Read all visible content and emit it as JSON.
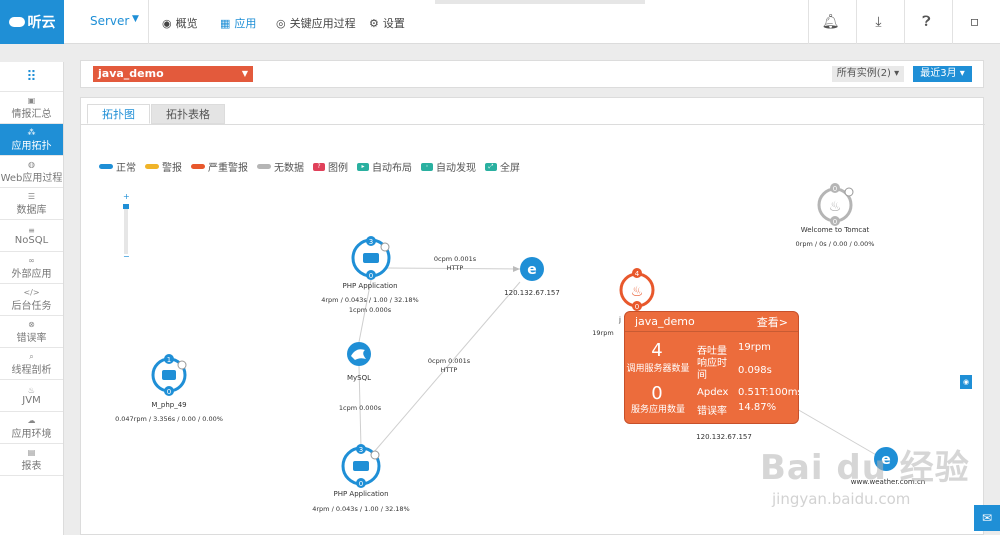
{
  "app": {
    "brand": "听云",
    "product_selector": "Server"
  },
  "topnav": {
    "items": [
      {
        "label": "概览",
        "icon": "eye-icon"
      },
      {
        "label": "应用",
        "icon": "grid-icon"
      },
      {
        "label": "关键应用过程",
        "icon": "target-icon"
      },
      {
        "label": "设置",
        "icon": "gear-icon"
      }
    ],
    "active": "应用",
    "right_icons": [
      "bell-icon",
      "download-icon",
      "help-icon",
      "user-icon"
    ]
  },
  "sidebar": {
    "items": [
      {
        "label": "情报汇总"
      },
      {
        "label": "应用拓扑",
        "active": true
      },
      {
        "label": "Web应用过程"
      },
      {
        "label": "数据库"
      },
      {
        "label": "NoSQL"
      },
      {
        "label": "外部应用"
      },
      {
        "label": "后台任务"
      },
      {
        "label": "错误率"
      },
      {
        "label": "线程剖析"
      },
      {
        "label": "JVM"
      },
      {
        "label": "应用环境"
      },
      {
        "label": "报表"
      }
    ]
  },
  "filters": {
    "app_name": "java_demo",
    "instances": "所有实例(2)",
    "time_range": "最近3月"
  },
  "tabs": [
    {
      "label": "拓扑图",
      "active": true
    },
    {
      "label": "拓扑表格",
      "active": false
    }
  ],
  "legend": [
    {
      "label": "正常",
      "color": "#1f8fd6"
    },
    {
      "label": "警报",
      "color": "#f0b429"
    },
    {
      "label": "严重警报",
      "color": "#e8582c"
    },
    {
      "label": "无数据",
      "color": "#b5b5b5"
    },
    {
      "label": "图例",
      "color": "#e0405a"
    },
    {
      "label": "自动布局",
      "color": "#2ab0a0"
    },
    {
      "label": "自动发现",
      "color": "#2ab0a0"
    },
    {
      "label": "全屏",
      "color": "#2ab0a0"
    }
  ],
  "zoom": {
    "plus": "+",
    "minus": "−"
  },
  "topology": {
    "nodes": {
      "php_app_top": {
        "label": "PHP Application",
        "stats": "4rpm / 0.043s / 1.00 / 32.18%",
        "badge_top": "3",
        "badge_bottom": "0"
      },
      "external_top": {
        "label": "120.132.67.157",
        "glyph": "e"
      },
      "mysql": {
        "label": "MySQL"
      },
      "php_app_bottom": {
        "label": "PHP Application",
        "stats": "4rpm / 0.043s / 1.00 / 32.18%",
        "badge_top": "3",
        "badge_bottom": "0"
      },
      "m_php": {
        "label": "M_php_49",
        "stats": "0.047rpm / 3.356s / 0.00 / 0.00%",
        "badge_top": "1",
        "badge_bottom": "0"
      },
      "java_demo": {
        "label": "j",
        "stats": "19rpm",
        "badge_top": "4",
        "badge_bottom": "0"
      },
      "tomcat": {
        "label": "Welcome to Tomcat",
        "stats": "0rpm / 0s / 0.00 / 0.00%",
        "badge_top": "0",
        "badge_bottom": "0"
      },
      "external_bottom": {
        "label": "120.132.67.157"
      },
      "weather": {
        "label": "www.weather.com.cn",
        "glyph": "e"
      }
    },
    "edges": {
      "php_to_external": {
        "line1": "0cpm 0.001s",
        "line2": "HTTP"
      },
      "php_to_mysql": {
        "label": "1cpm 0.000s"
      },
      "mysql_to_php_bottom": {
        "label": "1cpm 0.000s"
      },
      "php_bottom_to_external": {
        "line1": "0cpm 0.001s",
        "line2": "HTTP"
      }
    }
  },
  "popover": {
    "title": "java_demo",
    "link": "查看>",
    "servers_count": "4",
    "servers_label": "调用服务器数量",
    "apps_count": "0",
    "apps_label": "服务应用数量",
    "metrics": [
      {
        "key": "吞吐量",
        "value": "19rpm"
      },
      {
        "key": "响应时间",
        "value": "0.098s"
      },
      {
        "key": "Apdex",
        "value": "0.51T:100ms"
      },
      {
        "key": "错误率",
        "value": "14.87%"
      }
    ]
  },
  "watermark": {
    "text": "Bai du 经验",
    "url": "jingyan.baidu.com"
  }
}
